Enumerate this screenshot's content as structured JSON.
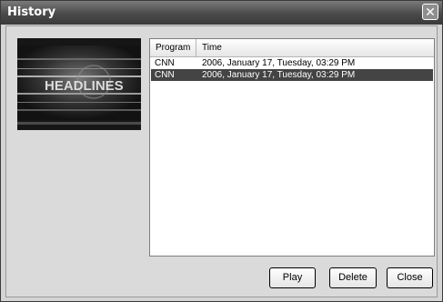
{
  "window": {
    "title": "History",
    "close_glyph": "✕"
  },
  "thumbnail": {
    "caption": "HEADLINES"
  },
  "list": {
    "columns": [
      "Program",
      "Time"
    ],
    "rows": [
      {
        "program": "CNN",
        "time": "2006, January 17, Tuesday, 03:29 PM",
        "selected": false
      },
      {
        "program": "CNN",
        "time": "2006, January 17, Tuesday, 03:29 PM",
        "selected": true
      }
    ]
  },
  "buttons": {
    "play": "Play",
    "delete": "Delete",
    "close": "Close"
  },
  "colors": {
    "titlebar": "#4a4a4a",
    "selection": "#444444",
    "body": "#dadada"
  },
  "icons": {
    "close": "close-icon"
  }
}
